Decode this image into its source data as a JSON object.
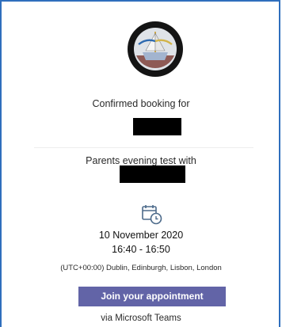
{
  "booking": {
    "confirmed_label": "Confirmed booking for",
    "service_label": "Parents evening test with"
  },
  "schedule": {
    "date": "10 November 2020",
    "time": "16:40 - 16:50",
    "timezone": "(UTC+00:00) Dublin, Edinburgh, Lisbon, London"
  },
  "actions": {
    "join_label": "Join your appointment",
    "via_label": "via Microsoft Teams"
  },
  "colors": {
    "frame": "#2f6fbd",
    "button": "#6264a7",
    "calendar_icon": "#4c6a8a"
  },
  "icons": {
    "logo": "school-crest-logo",
    "calendar": "calendar-clock-icon"
  }
}
